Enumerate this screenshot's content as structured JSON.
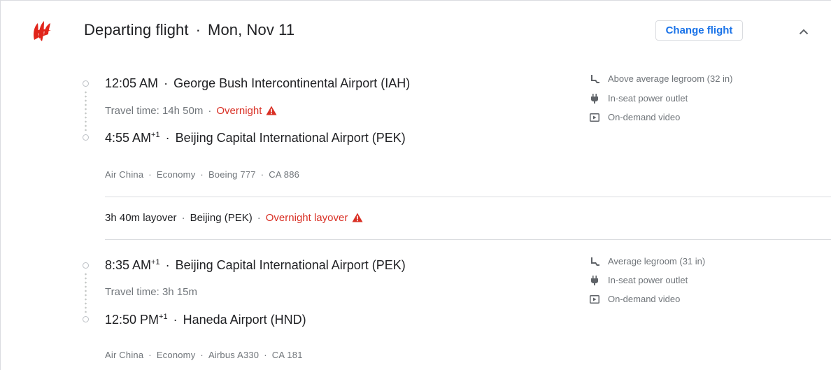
{
  "header": {
    "title": "Departing flight",
    "separator": "·",
    "date": "Mon, Nov 11",
    "change_button": "Change flight",
    "airline_logo": "air-china-logo"
  },
  "colors": {
    "accent": "#1a73e8",
    "warning": "#d93025",
    "muted": "#70757a"
  },
  "segments": [
    {
      "departure_time": "12:05 AM",
      "departure_airport": "George Bush Intercontinental Airport (IAH)",
      "travel_time": "Travel time: 14h 50m",
      "overnight": "Overnight",
      "arrival_time": "4:55 AM",
      "arrival_day_offset": "+1",
      "arrival_airport": "Beijing Capital International Airport (PEK)",
      "meta": [
        "Air China",
        "Economy",
        "Boeing 777",
        "CA 886"
      ],
      "amenities": [
        {
          "icon": "legroom-icon",
          "label": "Above average legroom (32 in)"
        },
        {
          "icon": "power-icon",
          "label": "In-seat power outlet"
        },
        {
          "icon": "video-icon",
          "label": "On-demand video"
        }
      ]
    },
    {
      "departure_time": "8:35 AM",
      "departure_day_offset": "+1",
      "departure_airport": "Beijing Capital International Airport (PEK)",
      "travel_time": "Travel time: 3h 15m",
      "arrival_time": "12:50 PM",
      "arrival_day_offset": "+1",
      "arrival_airport": "Haneda Airport (HND)",
      "meta": [
        "Air China",
        "Economy",
        "Airbus A330",
        "CA 181"
      ],
      "amenities": [
        {
          "icon": "legroom-icon",
          "label": "Average legroom (31 in)"
        },
        {
          "icon": "power-icon",
          "label": "In-seat power outlet"
        },
        {
          "icon": "video-icon",
          "label": "On-demand video"
        }
      ]
    }
  ],
  "layover": {
    "duration": "3h 40m layover",
    "city": "Beijing (PEK)",
    "warning": "Overnight layover"
  }
}
